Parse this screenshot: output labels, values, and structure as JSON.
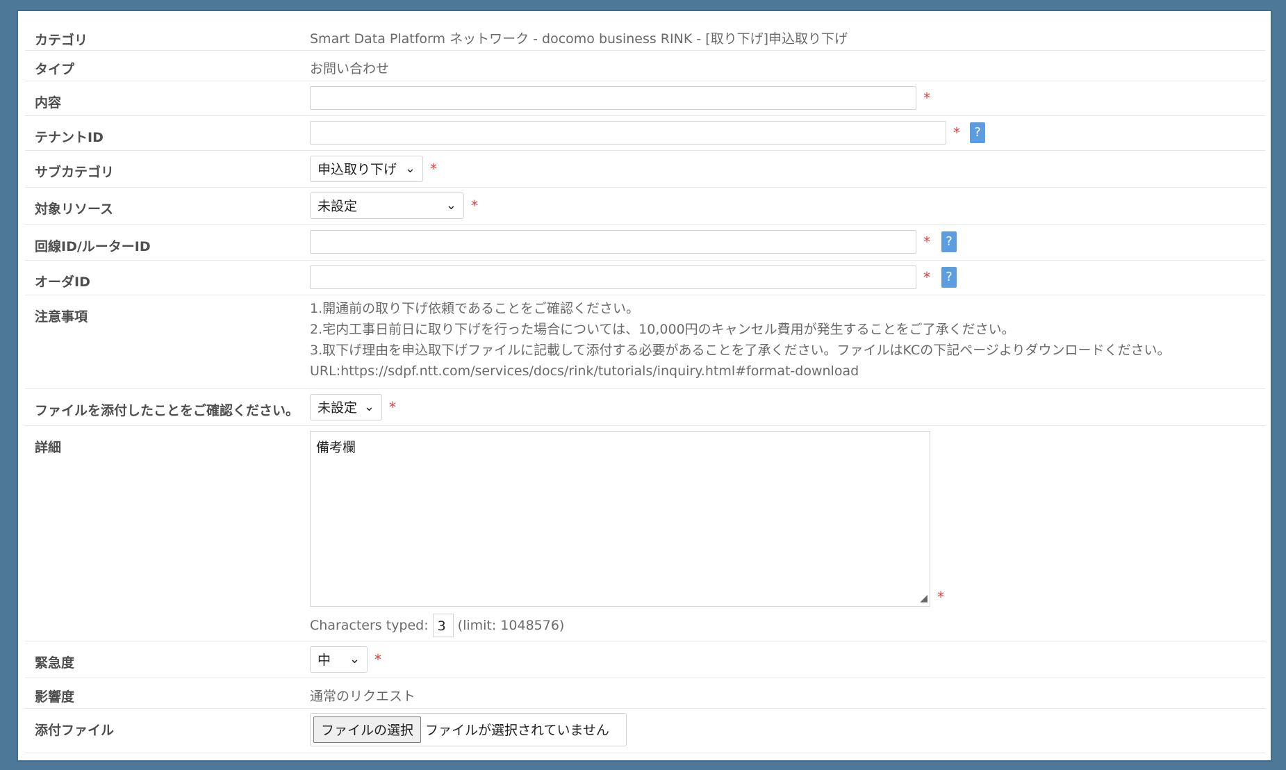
{
  "rows": {
    "category": {
      "label": "カテゴリ",
      "value": "Smart Data Platform ネットワーク - docomo business RINK - [取り下げ]申込取り下げ"
    },
    "type": {
      "label": "タイプ",
      "value": "お問い合わせ"
    },
    "content": {
      "label": "内容",
      "value": ""
    },
    "tenant_id": {
      "label": "テナントID",
      "value": ""
    },
    "subcategory": {
      "label": "サブカテゴリ",
      "selected": "申込取り下げ"
    },
    "target_resource": {
      "label": "対象リソース",
      "selected": "未設定"
    },
    "line_router_id": {
      "label": "回線ID/ルーターID",
      "value": ""
    },
    "order_id": {
      "label": "オーダID",
      "value": ""
    },
    "notes": {
      "label": "注意事項",
      "lines": [
        "1.開通前の取り下げ依頼であることをご確認ください。",
        "2.宅内工事日前日に取り下げを行った場合については、10,000円のキャンセル費用が発生することをご了承ください。",
        "3.取下げ理由を申込取下げファイルに記載して添付する必要があることを了承ください。ファイルはKCの下記ページよりダウンロードください。",
        "URL:https://sdpf.ntt.com/services/docs/rink/tutorials/inquiry.html#format-download"
      ]
    },
    "file_confirm": {
      "label": "ファイルを添付したことをご確認ください。",
      "selected": "未設定"
    },
    "details": {
      "label": "詳細",
      "value": "備考欄",
      "counter_prefix": "Characters typed:",
      "counter_value": "3",
      "counter_limit": "(limit: 1048576)"
    },
    "urgency": {
      "label": "緊急度",
      "selected": "中"
    },
    "impact": {
      "label": "影響度",
      "value": "通常のリクエスト"
    },
    "attachment": {
      "label": "添付ファイル",
      "button": "ファイルの選択",
      "status": "ファイルが選択されていません"
    }
  },
  "symbols": {
    "required": "*",
    "help": "?",
    "chevron": "⌄"
  },
  "colors": {
    "required": "#e04040",
    "help_bg": "#5b9de0",
    "frame_bg": "#4e7897"
  }
}
